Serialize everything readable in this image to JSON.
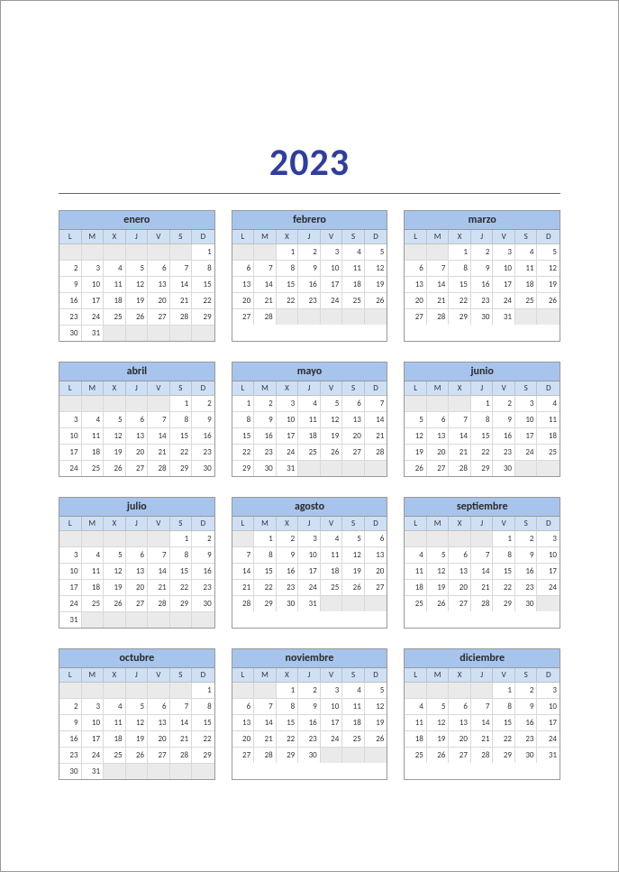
{
  "year": "2023",
  "dow": [
    "L",
    "M",
    "X",
    "J",
    "V",
    "S",
    "D"
  ],
  "months": [
    {
      "name": "enero",
      "startDow": 6,
      "days": 31
    },
    {
      "name": "febrero",
      "startDow": 2,
      "days": 28
    },
    {
      "name": "marzo",
      "startDow": 2,
      "days": 31
    },
    {
      "name": "abril",
      "startDow": 5,
      "days": 30
    },
    {
      "name": "mayo",
      "startDow": 0,
      "days": 31
    },
    {
      "name": "junio",
      "startDow": 3,
      "days": 30
    },
    {
      "name": "julio",
      "startDow": 5,
      "days": 31
    },
    {
      "name": "agosto",
      "startDow": 1,
      "days": 31
    },
    {
      "name": "septiembre",
      "startDow": 4,
      "days": 30
    },
    {
      "name": "octubre",
      "startDow": 6,
      "days": 31
    },
    {
      "name": "noviembre",
      "startDow": 2,
      "days": 30
    },
    {
      "name": "diciembre",
      "startDow": 4,
      "days": 31
    }
  ]
}
